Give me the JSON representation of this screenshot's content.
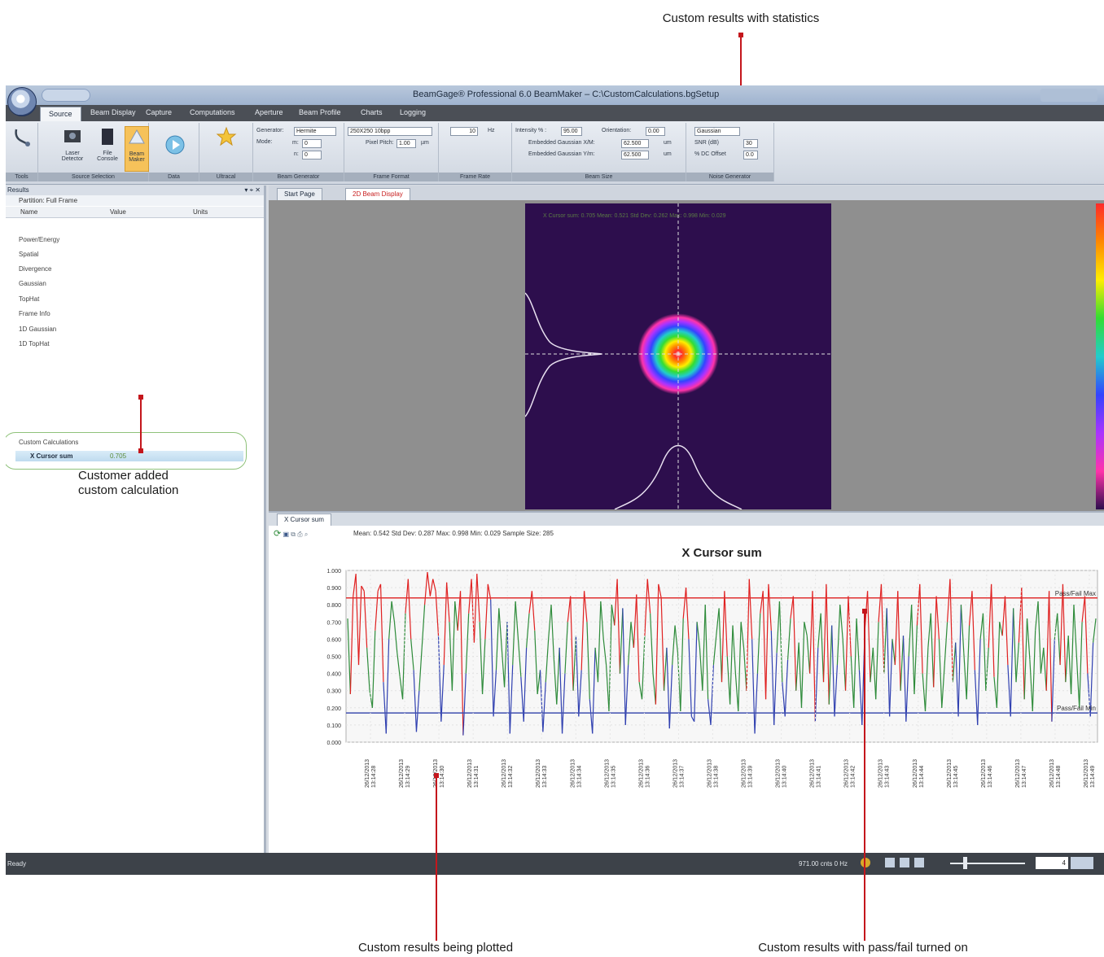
{
  "callouts": {
    "top": "Custom results with statistics",
    "left_line1": "Customer added",
    "left_line2": "custom calculation",
    "bottom_left": "Custom results being plotted",
    "bottom_right": "Custom results with pass/fail turned on"
  },
  "window": {
    "title": "BeamGage® Professional 6.0 BeamMaker – C:\\CustomCalculations.bgSetup"
  },
  "ribbon": {
    "tabs": [
      "Source",
      "Beam Display",
      "Capture",
      "Computations",
      "Aperture",
      "Beam Profile",
      "Charts",
      "Logging"
    ],
    "active_tab": "Source",
    "groups": {
      "tools": "Tools",
      "source_selection": "Source Selection",
      "data": "Data",
      "ultracal": "Ultracal",
      "beam_generator": "Beam Generator",
      "frame_format": "Frame Format",
      "frame_rate": "Frame Rate",
      "beam_size": "Beam Size",
      "noise_generator": "Noise Generator"
    },
    "buttons": {
      "laser_detector": "Laser Detector",
      "file_console": "File Console",
      "beam_maker": "Beam Maker"
    },
    "fields": {
      "generator_label": "Generator:",
      "generator_value": "Hermite",
      "mode_label": "Mode:",
      "m_label": "m:",
      "m_value": "0",
      "n_label": "n:",
      "n_value": "0",
      "frame_format_value": "250X250 10bpp",
      "pixel_pitch_label": "Pixel Pitch:",
      "pixel_pitch_value": "1.00",
      "pixel_pitch_unit": "µm",
      "frame_rate_value": "10",
      "frame_rate_unit": "Hz",
      "intensity_label": "Intensity % :",
      "intensity_value": "95.00",
      "orientation_label": "Orientation:",
      "orientation_value": "0.00",
      "gauss_x_label": "Embedded Gaussian X/M:",
      "gauss_x_value": "62.500",
      "gauss_y_label": "Embedded Gaussian Y/m:",
      "gauss_y_value": "62.500",
      "um_unit": "um",
      "noise_type": "Gaussian",
      "snr_label": "SNR (dB)",
      "snr_value": "30",
      "dc_offset_label": "% DC Offset",
      "dc_offset_value": "0.0"
    }
  },
  "results": {
    "title": "Results",
    "controls": "▾ ⌖ ✕",
    "partition": "Partition: Full Frame",
    "columns": [
      "Name",
      "Value",
      "Units"
    ],
    "items": [
      "Power/Energy",
      "Spatial",
      "Divergence",
      "Gaussian",
      "TopHat",
      "Frame Info",
      "1D Gaussian",
      "1D TopHat"
    ],
    "custom_header": "Custom Calculations",
    "custom_row": {
      "name": "X Cursor sum",
      "value": "0.705"
    }
  },
  "display": {
    "tabs": [
      "Start Page",
      "2D Beam Display"
    ],
    "beam_stats": "X Cursor sum: 0.705   Mean: 0.521   Std Dev: 0.262   Max: 0.998   Min: 0.029"
  },
  "chart_panel": {
    "tab": "X Cursor sum",
    "stats": "Mean: 0.542   Std Dev: 0.287   Max: 0.998   Min: 0.029   Sample Size: 285"
  },
  "status": {
    "ready": "Ready",
    "fps": "971.00 cnts  0 Hz",
    "zoom": "4"
  },
  "colors": {
    "green_series": "#2e8b3a",
    "red_series": "#e02020",
    "blue_series": "#3040b0",
    "pass_fail_max": "#e03030",
    "pass_fail_min": "#4050b0",
    "callout": "#c4161c"
  },
  "chart_data": {
    "type": "line",
    "title": "X Cursor sum",
    "xlabel": "",
    "ylabel": "",
    "ylim": [
      0,
      1.0
    ],
    "yticks": [
      "1.000",
      "0.900",
      "0.800",
      "0.700",
      "0.600",
      "0.500",
      "0.400",
      "0.300",
      "0.200",
      "0.100",
      "0.000"
    ],
    "x_tick_labels": [
      "26/12/2013 13:14:28",
      "26/12/2013 13:14:29",
      "26/12/2013 13:14:30",
      "26/12/2013 13:14:31",
      "26/12/2013 13:14:32",
      "26/12/2013 13:14:33",
      "26/12/2013 13:14:34",
      "26/12/2013 13:14:35",
      "26/12/2013 13:14:36",
      "26/12/2013 13:14:37",
      "26/12/2013 13:14:38",
      "26/12/2013 13:14:39",
      "26/12/2013 13:14:40",
      "26/12/2013 13:14:41",
      "26/12/2013 13:14:42",
      "26/12/2013 13:14:43",
      "26/12/2013 13:14:44",
      "26/12/2013 13:14:45",
      "26/12/2013 13:14:46",
      "26/12/2013 13:14:47",
      "26/12/2013 13:14:48",
      "26/12/2013 13:14:49"
    ],
    "thresholds": [
      {
        "name": "Pass/Fail Max",
        "value": 0.84
      },
      {
        "name": "Pass/Fail Min",
        "value": 0.17
      }
    ],
    "series": [
      {
        "values": [
          0.72,
          0.28,
          0.85,
          0.98,
          0.45,
          0.91,
          0.88,
          0.55,
          0.3,
          0.2,
          0.65,
          0.88,
          0.92,
          0.35,
          0.05,
          0.6,
          0.82,
          0.7,
          0.52,
          0.38,
          0.25,
          0.75,
          0.95,
          0.6,
          0.42,
          0.06,
          0.3,
          0.55,
          0.8,
          0.99,
          0.85,
          0.95,
          0.88,
          0.62,
          0.12,
          0.45,
          0.93,
          0.7,
          0.3,
          0.82,
          0.65,
          0.88,
          0.04,
          0.4,
          0.75,
          0.95,
          0.58,
          0.98,
          0.7,
          0.28,
          0.6,
          0.92,
          0.83,
          0.15,
          0.42,
          0.78,
          0.55,
          0.32,
          0.7,
          0.05,
          0.45,
          0.82,
          0.6,
          0.38,
          0.12,
          0.55,
          0.75,
          0.88,
          0.65,
          0.28,
          0.42,
          0.06,
          0.35,
          0.6,
          0.8,
          0.48,
          0.22,
          0.55,
          0.05,
          0.4,
          0.7,
          0.85,
          0.3,
          0.62,
          0.15,
          0.42,
          0.88,
          0.7,
          0.25,
          0.05,
          0.55,
          0.35,
          0.82,
          0.6,
          0.45,
          0.18,
          0.8,
          0.68,
          0.95,
          0.4,
          0.78,
          0.1,
          0.45,
          0.7,
          0.55,
          0.86,
          0.35,
          0.25,
          0.62,
          0.95,
          0.75,
          0.4,
          0.22,
          0.92,
          0.84,
          0.3,
          0.55,
          0.08,
          0.45,
          0.68,
          0.52,
          0.18,
          0.72,
          0.9,
          0.6,
          0.15,
          0.12,
          0.7,
          0.55,
          0.3,
          0.8,
          0.25,
          0.1,
          0.45,
          0.62,
          0.78,
          0.35,
          0.88,
          0.5,
          0.22,
          0.68,
          0.4,
          0.18,
          0.7,
          0.55,
          0.3,
          0.95,
          0.6,
          0.05,
          0.4,
          0.75,
          0.88,
          0.25,
          0.92,
          0.65,
          0.1,
          0.52,
          0.82,
          0.35,
          0.15,
          0.48,
          0.72,
          0.85,
          0.3,
          0.58,
          0.2,
          0.7,
          0.62,
          0.4,
          0.88,
          0.12,
          0.55,
          0.75,
          0.35,
          0.92,
          0.22,
          0.68,
          0.15,
          0.45,
          0.8,
          0.6,
          0.3,
          0.85,
          0.5,
          0.2,
          0.72,
          0.42,
          0.1,
          0.65,
          0.88,
          0.35,
          0.55,
          0.25,
          0.7,
          0.92,
          0.4,
          0.78,
          0.15,
          0.6,
          0.45,
          0.88,
          0.3,
          0.62,
          0.12,
          0.5,
          0.8,
          0.28,
          0.68,
          0.92,
          0.4,
          0.18,
          0.55,
          0.75,
          0.32,
          0.85,
          0.6,
          0.2,
          0.45,
          0.7,
          0.95,
          0.35,
          0.58,
          0.15,
          0.8,
          0.52,
          0.25,
          0.68,
          0.88,
          0.42,
          0.1,
          0.6,
          0.75,
          0.3,
          0.55,
          0.92,
          0.38,
          0.2,
          0.7,
          0.62,
          0.85,
          0.45,
          0.15,
          0.78,
          0.35,
          0.58,
          0.9,
          0.25,
          0.72,
          0.48,
          0.18,
          0.65,
          0.82,
          0.4,
          0.55,
          0.3,
          0.88,
          0.12,
          0.6,
          0.75,
          0.45,
          0.92,
          0.35,
          0.62,
          0.28,
          0.8,
          0.5,
          0.2,
          0.7,
          0.85,
          0.4,
          0.15,
          0.58,
          0.72
        ]
      }
    ]
  }
}
